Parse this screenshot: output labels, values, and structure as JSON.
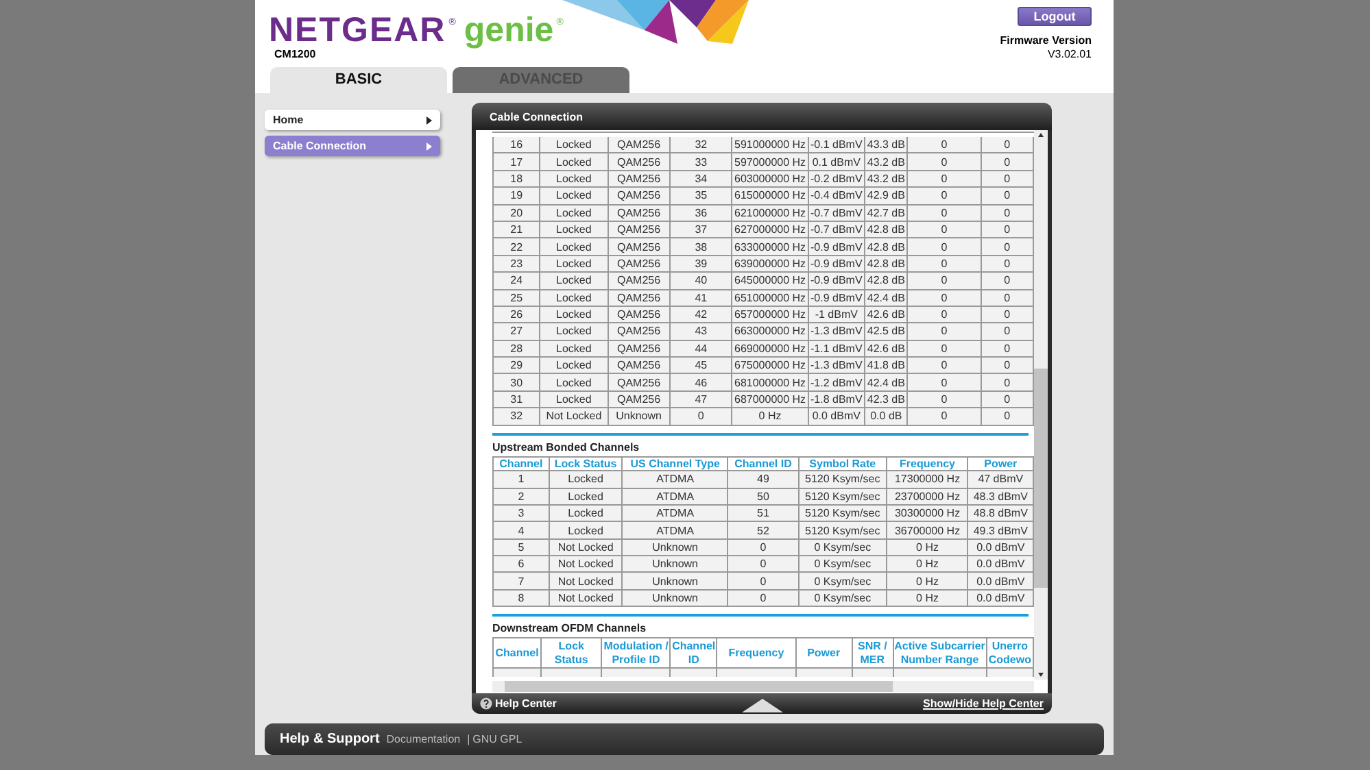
{
  "header": {
    "brand": "NETGEAR",
    "brand_mark": "®",
    "product": "genie",
    "product_mark": "®",
    "model": "CM1200",
    "logout": "Logout",
    "firmware_label": "Firmware Version",
    "firmware_value": "V3.02.01"
  },
  "tabs": [
    {
      "label": "BASIC",
      "selected": true
    },
    {
      "label": "ADVANCED",
      "selected": false
    }
  ],
  "sidebar": {
    "items": [
      {
        "label": "Home",
        "selected": false
      },
      {
        "label": "Cable Connection",
        "selected": true
      }
    ]
  },
  "panel": {
    "title": "Cable Connection",
    "downstream_rows": [
      [
        "16",
        "Locked",
        "QAM256",
        "32",
        "591000000 Hz",
        "-0.1 dBmV",
        "43.3 dB",
        "0",
        "0"
      ],
      [
        "17",
        "Locked",
        "QAM256",
        "33",
        "597000000 Hz",
        "0.1 dBmV",
        "43.2 dB",
        "0",
        "0"
      ],
      [
        "18",
        "Locked",
        "QAM256",
        "34",
        "603000000 Hz",
        "-0.2 dBmV",
        "43.2 dB",
        "0",
        "0"
      ],
      [
        "19",
        "Locked",
        "QAM256",
        "35",
        "615000000 Hz",
        "-0.4 dBmV",
        "42.9 dB",
        "0",
        "0"
      ],
      [
        "20",
        "Locked",
        "QAM256",
        "36",
        "621000000 Hz",
        "-0.7 dBmV",
        "42.7 dB",
        "0",
        "0"
      ],
      [
        "21",
        "Locked",
        "QAM256",
        "37",
        "627000000 Hz",
        "-0.7 dBmV",
        "42.8 dB",
        "0",
        "0"
      ],
      [
        "22",
        "Locked",
        "QAM256",
        "38",
        "633000000 Hz",
        "-0.9 dBmV",
        "42.8 dB",
        "0",
        "0"
      ],
      [
        "23",
        "Locked",
        "QAM256",
        "39",
        "639000000 Hz",
        "-0.9 dBmV",
        "42.8 dB",
        "0",
        "0"
      ],
      [
        "24",
        "Locked",
        "QAM256",
        "40",
        "645000000 Hz",
        "-0.9 dBmV",
        "42.8 dB",
        "0",
        "0"
      ],
      [
        "25",
        "Locked",
        "QAM256",
        "41",
        "651000000 Hz",
        "-0.9 dBmV",
        "42.4 dB",
        "0",
        "0"
      ],
      [
        "26",
        "Locked",
        "QAM256",
        "42",
        "657000000 Hz",
        "-1 dBmV",
        "42.6 dB",
        "0",
        "0"
      ],
      [
        "27",
        "Locked",
        "QAM256",
        "43",
        "663000000 Hz",
        "-1.3 dBmV",
        "42.5 dB",
        "0",
        "0"
      ],
      [
        "28",
        "Locked",
        "QAM256",
        "44",
        "669000000 Hz",
        "-1.1 dBmV",
        "42.6 dB",
        "0",
        "0"
      ],
      [
        "29",
        "Locked",
        "QAM256",
        "45",
        "675000000 Hz",
        "-1.3 dBmV",
        "41.8 dB",
        "0",
        "0"
      ],
      [
        "30",
        "Locked",
        "QAM256",
        "46",
        "681000000 Hz",
        "-1.2 dBmV",
        "42.4 dB",
        "0",
        "0"
      ],
      [
        "31",
        "Locked",
        "QAM256",
        "47",
        "687000000 Hz",
        "-1.8 dBmV",
        "42.3 dB",
        "0",
        "0"
      ],
      [
        "32",
        "Not Locked",
        "Unknown",
        "0",
        "0 Hz",
        "0.0 dBmV",
        "0.0 dB",
        "0",
        "0"
      ]
    ],
    "upstream": {
      "title": "Upstream Bonded Channels",
      "columns": [
        "Channel",
        "Lock Status",
        "US Channel Type",
        "Channel ID",
        "Symbol Rate",
        "Frequency",
        "Power"
      ],
      "rows": [
        [
          "1",
          "Locked",
          "ATDMA",
          "49",
          "5120 Ksym/sec",
          "17300000 Hz",
          "47 dBmV"
        ],
        [
          "2",
          "Locked",
          "ATDMA",
          "50",
          "5120 Ksym/sec",
          "23700000 Hz",
          "48.3 dBmV"
        ],
        [
          "3",
          "Locked",
          "ATDMA",
          "51",
          "5120 Ksym/sec",
          "30300000 Hz",
          "48.8 dBmV"
        ],
        [
          "4",
          "Locked",
          "ATDMA",
          "52",
          "5120 Ksym/sec",
          "36700000 Hz",
          "49.3 dBmV"
        ],
        [
          "5",
          "Not Locked",
          "Unknown",
          "0",
          "0 Ksym/sec",
          "0 Hz",
          "0.0 dBmV"
        ],
        [
          "6",
          "Not Locked",
          "Unknown",
          "0",
          "0 Ksym/sec",
          "0 Hz",
          "0.0 dBmV"
        ],
        [
          "7",
          "Not Locked",
          "Unknown",
          "0",
          "0 Ksym/sec",
          "0 Hz",
          "0.0 dBmV"
        ],
        [
          "8",
          "Not Locked",
          "Unknown",
          "0",
          "0 Ksym/sec",
          "0 Hz",
          "0.0 dBmV"
        ]
      ]
    },
    "ofdm": {
      "title": "Downstream OFDM Channels",
      "columns": [
        "Channel",
        "Lock Status",
        "Modulation / Profile ID",
        "Channel ID",
        "Frequency",
        "Power",
        "SNR / MER",
        "Active Subcarrier Number Range",
        "Unerro Codewo"
      ]
    },
    "help_center": "Help Center",
    "toggle_help": "Show/Hide Help Center"
  },
  "footer": {
    "title": "Help & Support",
    "links": [
      "Documentation",
      "GNU GPL"
    ],
    "separator": "|"
  }
}
